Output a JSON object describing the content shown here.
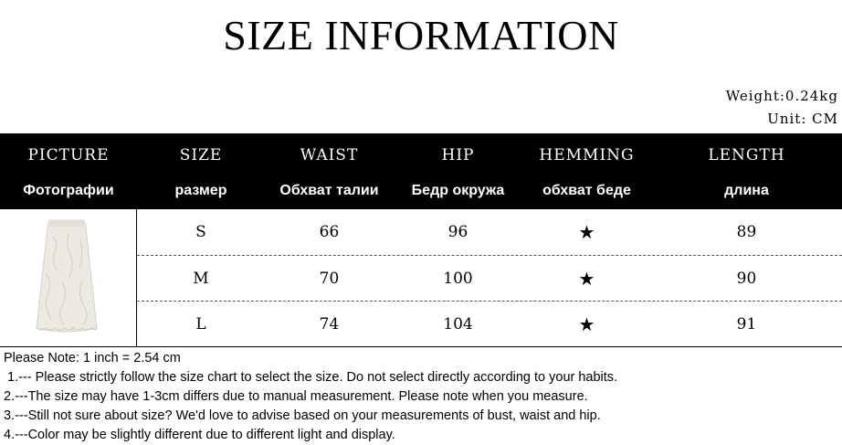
{
  "title": "SIZE INFORMATION",
  "weight": "Weight:0.24kg",
  "unit": "Unit: CM",
  "headers": [
    {
      "en": "PICTURE",
      "ru": "Фотографии"
    },
    {
      "en": "SIZE",
      "ru": "размер"
    },
    {
      "en": "WAIST",
      "ru": "Обхват талии"
    },
    {
      "en": "HIP",
      "ru": "Бедр окружа"
    },
    {
      "en": "HEMMING",
      "ru": "обхват беде"
    },
    {
      "en": "LENGTH",
      "ru": "длина"
    }
  ],
  "rows": [
    {
      "size": "S",
      "waist": "66",
      "hip": "96",
      "hemming": "★",
      "length": "89"
    },
    {
      "size": "M",
      "waist": "70",
      "hip": "100",
      "hemming": "★",
      "length": "90"
    },
    {
      "size": "L",
      "waist": "74",
      "hip": "104",
      "hemming": "★",
      "length": "91"
    }
  ],
  "notes": {
    "intro": "Please Note: 1 inch = 2.54 cm",
    "items": [
      "1.--- Please strictly follow the size chart to select the size. Do not select directly according to your habits.",
      "2.---The size may have 1-3cm differs due to manual measurement. Please note when you measure.",
      "3.---Still not sure about size? We'd love to advise based on your measurements of bust, waist and hip.",
      "4.---Color may be slightly different due to different light and display."
    ]
  },
  "colors": {
    "header_bg": "#000000",
    "header_text": "#ffffff",
    "skirt": "#ece9e3"
  },
  "icons": {
    "hemming": "star-icon",
    "picture": "skirt-image"
  }
}
